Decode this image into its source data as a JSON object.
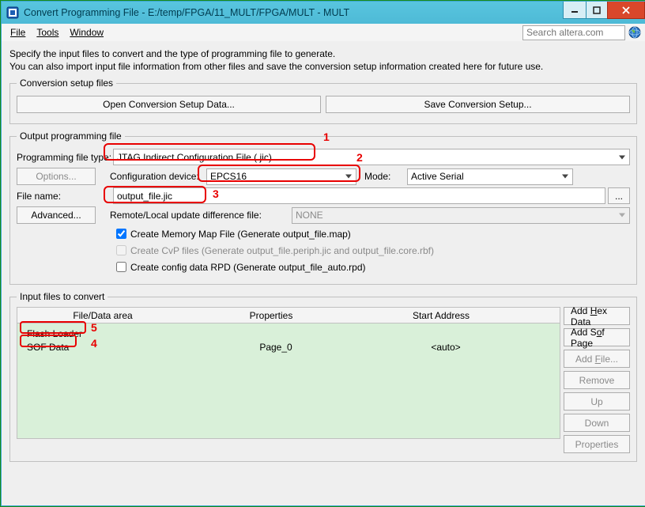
{
  "window": {
    "title": "Convert Programming File - E:/temp/FPGA/11_MULT/FPGA/MULT - MULT"
  },
  "menu": {
    "file": "File",
    "tools": "Tools",
    "window": "Window"
  },
  "search": {
    "placeholder": "Search altera.com"
  },
  "intro": {
    "line1": "Specify the input files to convert and the type of programming file to generate.",
    "line2": "You can also import input file information from other files and save the conversion setup information created here for future use."
  },
  "conversion": {
    "legend": "Conversion setup files",
    "open": "Open Conversion Setup Data...",
    "save": "Save Conversion Setup..."
  },
  "output": {
    "legend": "Output programming file",
    "type_label": "Programming file type:",
    "type_value": "JTAG Indirect Configuration File (.jic)",
    "options_btn": "Options...",
    "config_label": "Configuration device:",
    "config_value": "EPCS16",
    "mode_label": "Mode:",
    "mode_value": "Active Serial",
    "file_label": "File name:",
    "file_value": "output_file.jic",
    "dots_btn": "...",
    "advanced_btn": "Advanced...",
    "rldiff_label": "Remote/Local update difference file:",
    "rldiff_value": "NONE",
    "chk_map": "Create Memory Map File (Generate output_file.map)",
    "chk_cvp": "Create CvP files (Generate output_file.periph.jic and output_file.core.rbf)",
    "chk_rpd": "Create config data RPD (Generate output_file_auto.rpd)"
  },
  "input_files": {
    "legend": "Input files to convert",
    "head_filedata": "File/Data area",
    "head_props": "Properties",
    "head_start": "Start Address",
    "rows": [
      {
        "filedata": "Flash Loader",
        "props": "",
        "start": ""
      },
      {
        "filedata": "SOF Data",
        "props": "Page_0",
        "start": "<auto>"
      }
    ],
    "btn_addhex": "Add Hex Data",
    "btn_addsof": "Add Sof Page",
    "btn_addfile": "Add File...",
    "btn_remove": "Remove",
    "btn_up": "Up",
    "btn_down": "Down",
    "btn_props": "Properties"
  },
  "annotations": {
    "a1": "1",
    "a2": "2",
    "a3": "3",
    "a4": "4",
    "a5": "5"
  }
}
